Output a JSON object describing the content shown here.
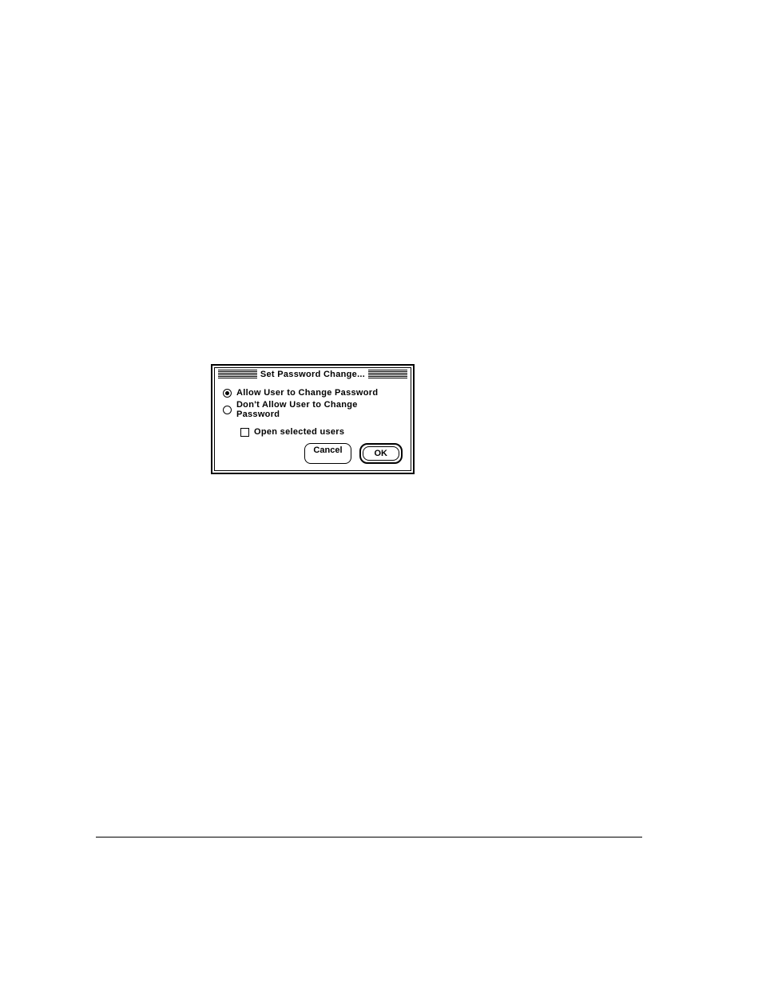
{
  "dialog": {
    "title": "Set Password Change...",
    "options": {
      "allow": {
        "label": "Allow User to Change Password",
        "selected": true
      },
      "dont_allow": {
        "label": "Don't Allow User to Change Password",
        "selected": false
      }
    },
    "open_selected_users": {
      "label": "Open selected users",
      "checked": false
    },
    "buttons": {
      "cancel": "Cancel",
      "ok": "OK"
    }
  }
}
